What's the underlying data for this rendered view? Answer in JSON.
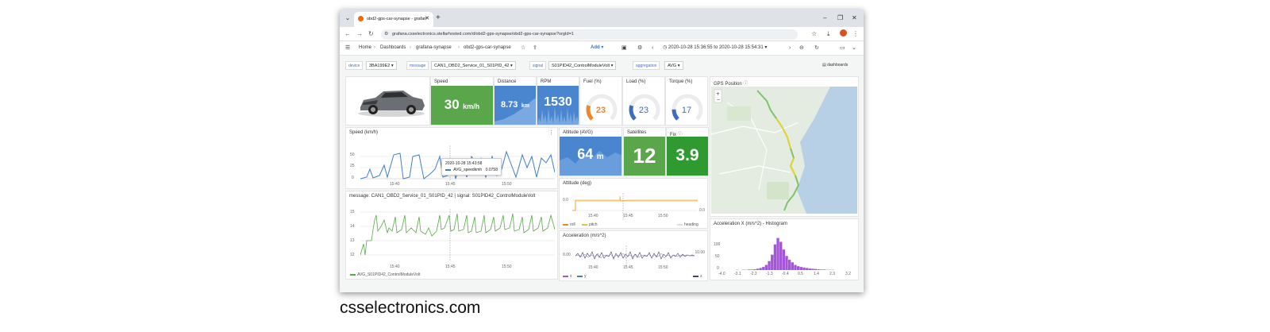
{
  "browser": {
    "tab_title": "obd2-gps-car-synapse - grafan",
    "tab_close": "✕",
    "new_tab": "+",
    "url": "grafana.csselectronics.stellarhosted.com/d/obd2-gps-synapse/obd2-gps-car-synapse?orgId=1"
  },
  "breadcrumb": [
    "Home",
    "Dashboards",
    "grafana-synapse",
    "obd2-gps-car-synapse"
  ],
  "toolbar": {
    "add_label": "Add",
    "time_range": "2020-10-28 15:36:55 to 2020-10-28 15:54:31"
  },
  "variables": {
    "device": {
      "label": "device",
      "value": "3BA199E2"
    },
    "message": {
      "label": "message",
      "value": "CAN1_OBD2_Service_01_S01PID_42"
    },
    "signal": {
      "label": "signal",
      "value": "S01PID42_ControlModuleVolt"
    },
    "aggregation": {
      "label": "aggregation",
      "value": "AVG"
    },
    "dashboards_link": "dashboards"
  },
  "stats": {
    "speed": {
      "title": "Speed",
      "value": "30",
      "unit": "km/h",
      "color": "#5aa64b"
    },
    "distance": {
      "title": "Distance",
      "value": "8.73",
      "unit": "km",
      "color": "#4a86cf"
    },
    "rpm": {
      "title": "RPM",
      "value": "1530",
      "color": "#4a86cf"
    },
    "fuel": {
      "title": "Fuel (%)",
      "value": "23",
      "color": "#f0862a",
      "level": 0.23
    },
    "load": {
      "title": "Load (%)",
      "value": "23",
      "color": "#3a6ec0",
      "level": 0.23
    },
    "torque": {
      "title": "Torque (%)",
      "value": "17",
      "color": "#3a6ec0",
      "level": 0.17
    },
    "altitude_avg": {
      "title": "Altitude (AVG)",
      "value": "64",
      "unit": "m",
      "color": "#4a86cf"
    },
    "satellites": {
      "title": "Satellites",
      "value": "12",
      "color": "#5aa64b"
    },
    "fix": {
      "title": "Fix",
      "value": "3.9",
      "color": "#2f9a2f"
    }
  },
  "gps": {
    "title": "GPS Position"
  },
  "speed_chart": {
    "title": "Speed (km/h)",
    "yticks": [
      "50",
      "25",
      "0"
    ],
    "xticks": [
      "15:40",
      "15:45",
      "15:50"
    ],
    "tooltip_time": "2020-10-28 15:43:58",
    "tooltip_series": "AVG_speedkmh",
    "tooltip_value": "0.0758"
  },
  "signal_chart": {
    "title": "message: CAN1_OBD2_Service_01_S01PID_42 | signal: S01PID42_ControlModuleVolt",
    "yticks": [
      "15",
      "14",
      "13",
      "12"
    ],
    "xticks": [
      "15:40",
      "15:45",
      "15:50"
    ],
    "legend": "AVG_S01PID42_ControlModuleVolt"
  },
  "attitude": {
    "title": "Attitude (deg)",
    "ytick_left": "0.0",
    "ytick_right": "0.0",
    "xticks": [
      "15:40",
      "15:45",
      "15:50"
    ],
    "legend": [
      "roll",
      "pitch",
      "heading"
    ]
  },
  "acceleration": {
    "title": "Acceleration (m/s^2)",
    "ytick_left": "0.00",
    "ytick_right": "10.00",
    "xticks": [
      "15:40",
      "15:45",
      "15:50"
    ],
    "legend": [
      "x",
      "y",
      "z"
    ]
  },
  "histogram": {
    "title": "Acceleration X (m/s^2) - Histogram",
    "yticks": [
      "100",
      "50",
      "0"
    ],
    "xticks": [
      "-4.0",
      "-3.1",
      "-2.2",
      "-1.3",
      "-0.4",
      "0.5",
      "1.4",
      "2.3",
      "3.2"
    ],
    "bars": [
      0,
      0,
      0,
      0,
      0,
      1,
      0,
      1,
      1,
      2,
      2,
      3,
      5,
      8,
      12,
      20,
      35,
      60,
      100,
      125,
      110,
      80,
      55,
      40,
      30,
      20,
      15,
      12,
      10,
      8,
      6,
      5,
      4,
      3,
      2,
      2,
      1,
      1,
      1,
      0,
      0,
      0,
      0,
      0,
      0,
      0
    ]
  },
  "caption": "csselectronics.com"
}
